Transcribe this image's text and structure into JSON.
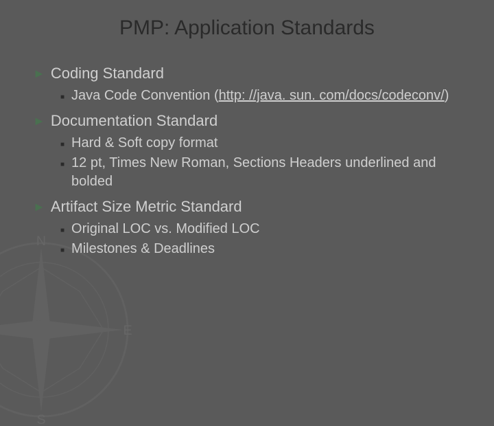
{
  "title": "PMP: Application Standards",
  "topics": {
    "t1": {
      "heading": "Coding Standard",
      "sub1_pre": "Java Code Convention (",
      "sub1_link": "http: //java. sun. com/docs/codeconv/",
      "sub1_post": ")"
    },
    "t2": {
      "heading": "Documentation Standard",
      "sub1": "Hard & Soft copy format",
      "sub2": "12 pt, Times New Roman, Sections Headers underlined and bolded"
    },
    "t3": {
      "heading": "Artifact Size Metric Standard",
      "sub1": "Original LOC vs. Modified LOC",
      "sub2": "Milestones & Deadlines"
    }
  }
}
